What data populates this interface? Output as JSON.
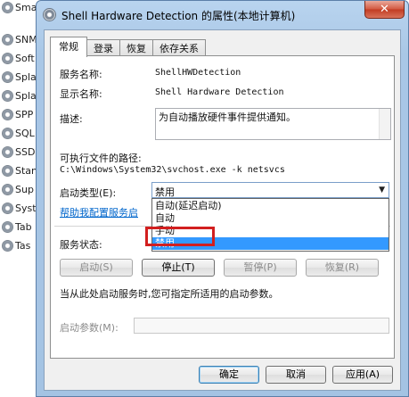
{
  "background_services": [
    "Sma",
    "SNM",
    "Soft",
    "Spla",
    "Spla",
    "SPP",
    "SQL",
    "SSD",
    "Stan",
    "Sup",
    "Syst",
    "Tab",
    "Tas"
  ],
  "window": {
    "title": "Shell Hardware Detection 的属性(本地计算机)",
    "close_glyph": "✕"
  },
  "tabs": [
    "常规",
    "登录",
    "恢复",
    "依存关系"
  ],
  "general": {
    "service_name_label": "服务名称:",
    "service_name_value": "ShellHWDetection",
    "display_name_label": "显示名称:",
    "display_name_value": "Shell Hardware Detection",
    "description_label": "描述:",
    "description_value": "为自动播放硬件事件提供通知。",
    "exe_path_label": "可执行文件的路径:",
    "exe_path_value": "C:\\Windows\\System32\\svchost.exe -k netsvcs",
    "startup_type_label": "启动类型(E):",
    "startup_type_selected": "禁用",
    "startup_options": [
      "自动(延迟启动)",
      "自动",
      "手动",
      "禁用"
    ],
    "help_link": "帮助我配置服务启",
    "service_status_label": "服务状态:",
    "buttons": {
      "start": "启动(S)",
      "stop": "停止(T)",
      "pause": "暂停(P)",
      "resume": "恢复(R)"
    },
    "hint_text": "当从此处启动服务时,您可指定所适用的启动参数。",
    "start_params_label": "启动参数(M):"
  },
  "footer": {
    "ok": "确定",
    "cancel": "取消",
    "apply": "应用(A)"
  }
}
